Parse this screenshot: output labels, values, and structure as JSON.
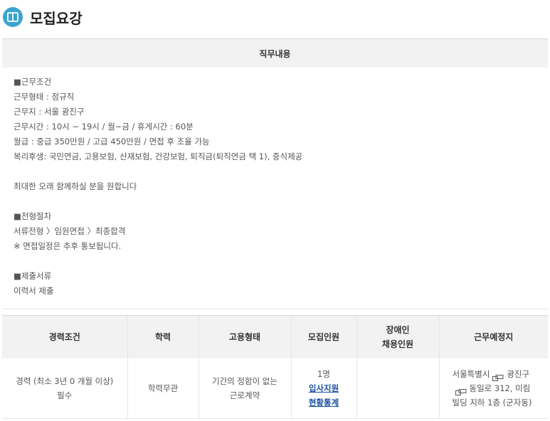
{
  "section": {
    "title": "모집요강",
    "icon": "book-icon"
  },
  "job": {
    "header": "직무내용",
    "lines": [
      "■근무조건",
      "근무형태 : 정규직",
      "근무지 : 서울 광진구",
      "근무시간 : 10시 ~ 19시 / 월~금 / 휴게시간 : 60분",
      "월급 : 중급 350만원 / 고급 450만원 / 면접 후 조율 가능",
      "복리후생: 국민연금, 고용보험, 산재보험, 건강보험, 퇴직금(퇴직연금 택 1), 중식제공",
      "",
      "최대한 오래 함께하실 분을 원합니다",
      "",
      "■전형절차",
      "서류전형 〉임원면접 〉최종합격",
      "※ 면접일정은 추후 통보됩니다.",
      "",
      "■제출서류",
      "이력서 제출"
    ]
  },
  "table": {
    "headers": {
      "career": "경력조건",
      "education": "학력",
      "employment": "고용형태",
      "recruit": "모집인원",
      "disabled_line1": "장애인",
      "disabled_line2": "채용인원",
      "location": "근무예정지"
    },
    "row": {
      "career_line1": "경력 (최소 3년 0 개월 이상)",
      "career_line2": "필수",
      "education": "학력무관",
      "employment_line1": "기간의 정함이 없는",
      "employment_line2": "근로계약",
      "recruit_count": "1명",
      "apply_link": "입사지원",
      "stats_link": "현황통계",
      "disabled": "",
      "location_part1": "서울특별시",
      "location_part2": "광진구",
      "location_part3": "동일로 312, 미림",
      "location_part4": "빌딩 지하 1층 (군자동)"
    }
  }
}
